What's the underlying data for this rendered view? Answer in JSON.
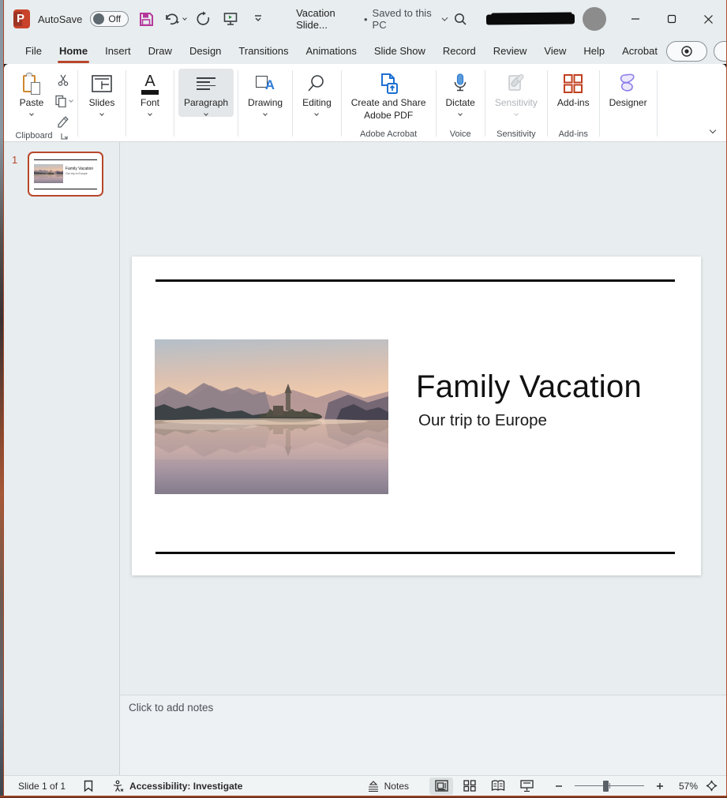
{
  "titlebar": {
    "autosave": "AutoSave",
    "autosave_state": "Off",
    "doc_title": "Vacation Slide...",
    "separator": "•",
    "save_status": "Saved to this PC"
  },
  "tabs": [
    "File",
    "Home",
    "Insert",
    "Draw",
    "Design",
    "Transitions",
    "Animations",
    "Slide Show",
    "Record",
    "Review",
    "View",
    "Help",
    "Acrobat"
  ],
  "active_tab": "Home",
  "ribbon": {
    "paste": "Paste",
    "clipboard_group": "Clipboard",
    "slides": "Slides",
    "font": "Font",
    "paragraph": "Paragraph",
    "drawing": "Drawing",
    "editing": "Editing",
    "acrobat_button_line1": "Create and Share",
    "acrobat_button_line2": "Adobe PDF",
    "acrobat_group": "Adobe Acrobat",
    "dictate": "Dictate",
    "voice_group": "Voice",
    "sensitivity": "Sensitivity",
    "sensitivity_group": "Sensitivity",
    "addins": "Add-ins",
    "addins_group": "Add-ins",
    "designer": "Designer"
  },
  "slide_panel": {
    "slide_number": "1"
  },
  "slide": {
    "title": "Family Vacation",
    "subtitle": "Our trip to Europe"
  },
  "notes": {
    "placeholder": "Click to add notes"
  },
  "statusbar": {
    "slide_info": "Slide 1 of 1",
    "accessibility_status": "Accessibility: Investigate",
    "notes_label": "Notes",
    "zoom_level": "57%"
  },
  "glyphs": {
    "font_a": "A",
    "drawing_a": "A"
  },
  "colors": {
    "accent": "#b7472a",
    "share_button": "#c8421e",
    "dictate_blue": "#2e7cd6",
    "addins_orange": "#c0401f",
    "designer_purple": "#8661c5",
    "selection_border": "#b7472a"
  }
}
